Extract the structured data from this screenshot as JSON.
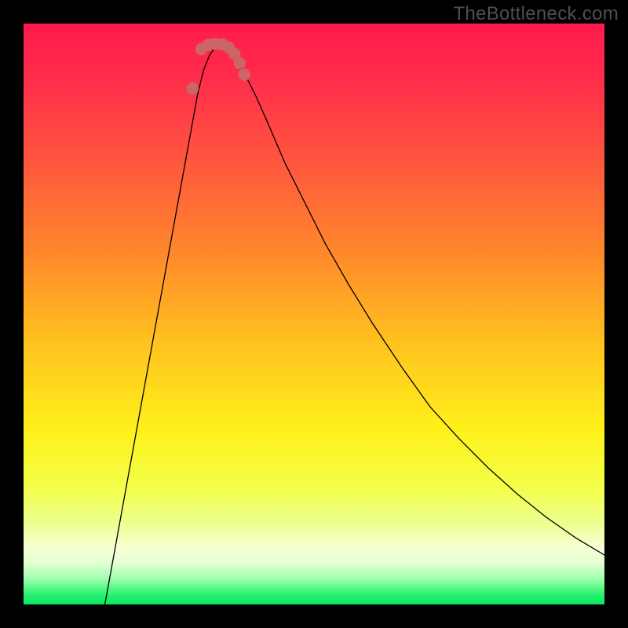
{
  "watermark": "TheBottleneck.com",
  "colors": {
    "frame": "#000000",
    "watermark": "#4f4f4f",
    "curve": "#000000",
    "marker": "#cc6666",
    "gradient_stops": [
      {
        "offset": 0.0,
        "color": "#ff1a4d"
      },
      {
        "offset": 0.1,
        "color": "#ff2e4a"
      },
      {
        "offset": 0.25,
        "color": "#ff5a3d"
      },
      {
        "offset": 0.4,
        "color": "#ff8a2a"
      },
      {
        "offset": 0.55,
        "color": "#ffc21f"
      },
      {
        "offset": 0.7,
        "color": "#fff11a"
      },
      {
        "offset": 0.8,
        "color": "#f3ff4a"
      },
      {
        "offset": 0.86,
        "color": "#ecff90"
      },
      {
        "offset": 0.905,
        "color": "#f7ffd6"
      },
      {
        "offset": 0.93,
        "color": "#e2ffd2"
      },
      {
        "offset": 0.955,
        "color": "#a1ffb0"
      },
      {
        "offset": 0.972,
        "color": "#57f984"
      },
      {
        "offset": 0.985,
        "color": "#23ef6e"
      },
      {
        "offset": 1.0,
        "color": "#10e765"
      }
    ]
  },
  "chart_data": {
    "type": "line",
    "title": "",
    "xlabel": "",
    "ylabel": "",
    "xlim": [
      0,
      100
    ],
    "ylim": [
      100,
      0
    ],
    "series": [
      {
        "name": "bottleneck-curve",
        "x": [
          14,
          16,
          18,
          20,
          22,
          24,
          26,
          28,
          29,
          30,
          31,
          32,
          33,
          33.5,
          34,
          35,
          36,
          37,
          38,
          40,
          42,
          45,
          48,
          52,
          56,
          60,
          65,
          70,
          75,
          80,
          85,
          90,
          95,
          100
        ],
        "y": [
          0,
          11,
          22,
          33,
          44,
          55,
          66,
          77,
          82.5,
          88,
          92,
          94.5,
          96,
          96.5,
          96.5,
          96,
          95,
          93.5,
          91.5,
          87.5,
          83,
          76,
          70,
          62,
          55,
          48.5,
          41,
          34,
          28.5,
          23.5,
          19,
          15,
          11.5,
          8.5
        ]
      }
    ],
    "markers": {
      "name": "highlight-markers",
      "radius": 1.05,
      "points": [
        {
          "x": 29.1,
          "y": 88.8
        },
        {
          "x": 30.6,
          "y": 95.6
        },
        {
          "x": 31.8,
          "y": 96.3
        },
        {
          "x": 33.0,
          "y": 96.5
        },
        {
          "x": 34.2,
          "y": 96.4
        },
        {
          "x": 35.3,
          "y": 95.9
        },
        {
          "x": 36.3,
          "y": 94.8
        },
        {
          "x": 37.2,
          "y": 93.2
        },
        {
          "x": 38.0,
          "y": 91.2
        }
      ]
    }
  }
}
